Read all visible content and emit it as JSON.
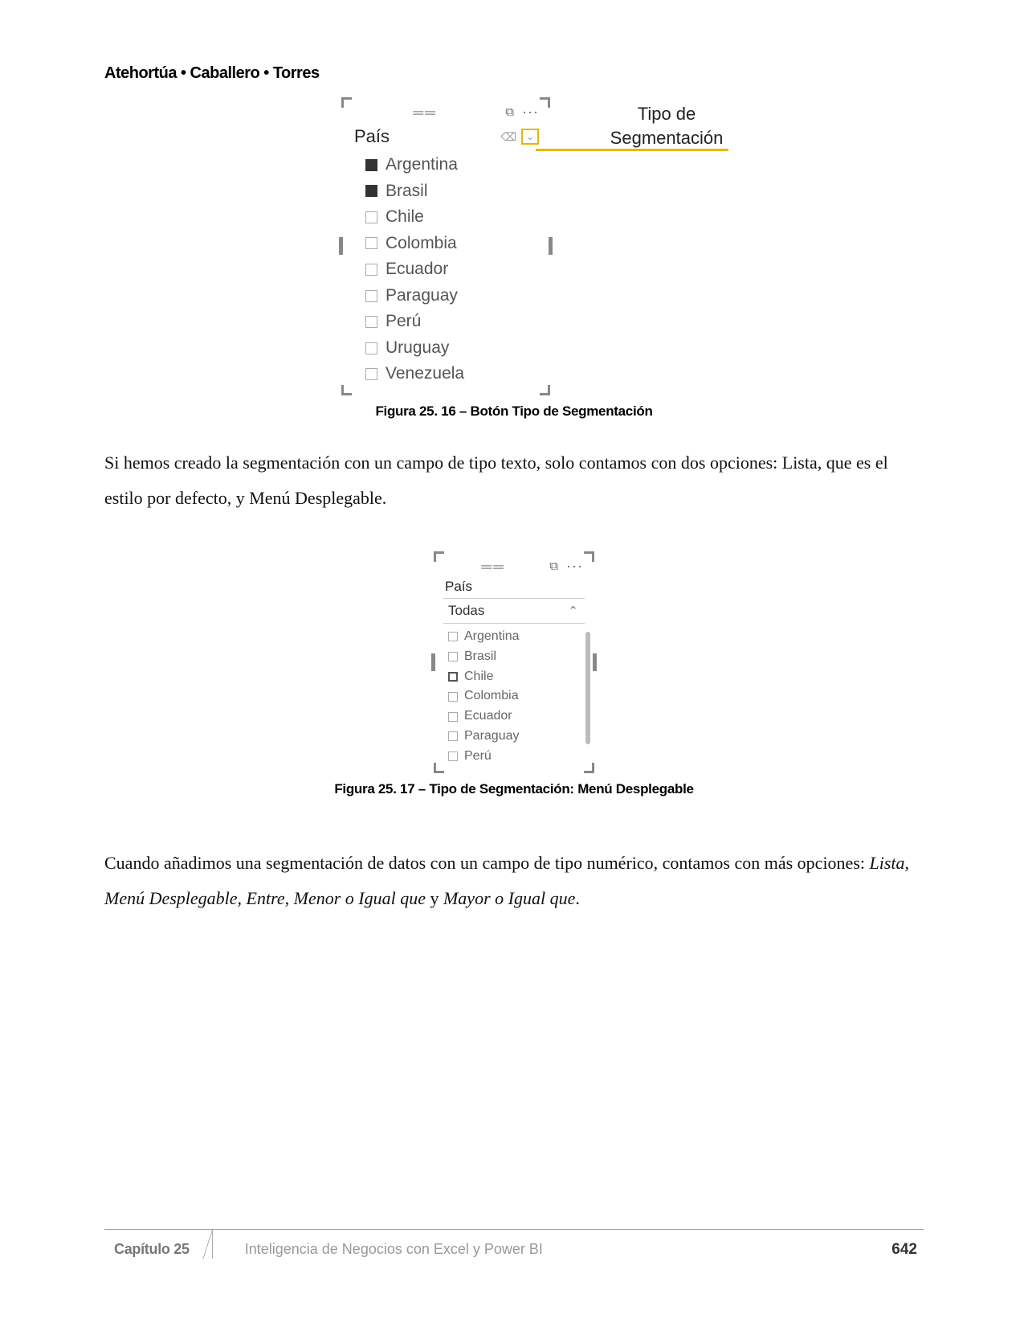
{
  "header": {
    "authors": "Atehortúa • Caballero • Torres"
  },
  "callout": {
    "line1": "Tipo de",
    "line2": "Segmentación"
  },
  "slicer1": {
    "title": "País",
    "type_dropdown_glyph": "⌄",
    "items": [
      {
        "label": "Argentina",
        "checked": true
      },
      {
        "label": "Brasil",
        "checked": true
      },
      {
        "label": "Chile",
        "checked": false
      },
      {
        "label": "Colombia",
        "checked": false
      },
      {
        "label": "Ecuador",
        "checked": false
      },
      {
        "label": "Paraguay",
        "checked": false
      },
      {
        "label": "Perú",
        "checked": false
      },
      {
        "label": "Uruguay",
        "checked": false
      },
      {
        "label": "Venezuela",
        "checked": false
      }
    ],
    "caption": "Figura 25. 16 – Botón Tipo de Segmentación"
  },
  "para1": "Si hemos creado la segmentación con un campo de tipo texto, solo contamos con dos opciones: Lista, que es el estilo por defecto, y Menú Desplegable.",
  "slicer2": {
    "title": "País",
    "dropdown_label": "Todas",
    "chevron": "⌃",
    "items": [
      {
        "label": "Argentina",
        "bold": false
      },
      {
        "label": "Brasil",
        "bold": false
      },
      {
        "label": "Chile",
        "bold": true
      },
      {
        "label": "Colombia",
        "bold": false
      },
      {
        "label": "Ecuador",
        "bold": false
      },
      {
        "label": "Paraguay",
        "bold": false
      },
      {
        "label": "Perú",
        "bold": false
      }
    ],
    "caption": "Figura 25. 17 – Tipo de Segmentación: Menú Desplegable"
  },
  "para2_a": "Cuando añadimos una segmentación de datos con un campo de tipo numérico, contamos con más opciones: ",
  "para2_b": "Lista, Menú Desplegable, Entre, Menor o Igual que ",
  "para2_c": "y ",
  "para2_d": "Mayor o Igual que",
  "para2_e": ".",
  "footer": {
    "chapter": "Capítulo 25",
    "title": "Inteligencia de Negocios con Excel y Power BI",
    "page": "642"
  }
}
